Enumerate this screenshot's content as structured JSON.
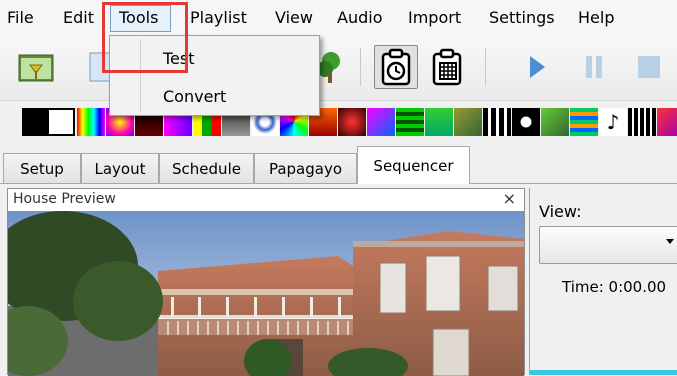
{
  "menu": {
    "items": [
      "File",
      "Edit",
      "Tools",
      "Playlist",
      "View",
      "Audio",
      "Import",
      "Settings",
      "Help"
    ],
    "open_menu": "Tools"
  },
  "tools_menu": {
    "items": [
      "Test",
      "Convert"
    ]
  },
  "toolbar": {
    "icons": [
      "folder-icon",
      "clipboard-clock-icon",
      "clipboard-grid-icon",
      "play-icon",
      "pause-icon",
      "stop-icon"
    ],
    "pressed": "clipboard-clock-icon"
  },
  "tabs": {
    "items": [
      "Setup",
      "Layout",
      "Schedule",
      "Papagayo",
      "Sequencer"
    ],
    "active": "Sequencer"
  },
  "preview": {
    "title": "House Preview",
    "close_symbol": "×"
  },
  "view_panel": {
    "label": "View:",
    "selected": "",
    "time": "Time: 0:00.00"
  },
  "colors": {
    "highlight": "#e53935",
    "accent": "#3cc6e6",
    "play": "#4a8fd6"
  }
}
